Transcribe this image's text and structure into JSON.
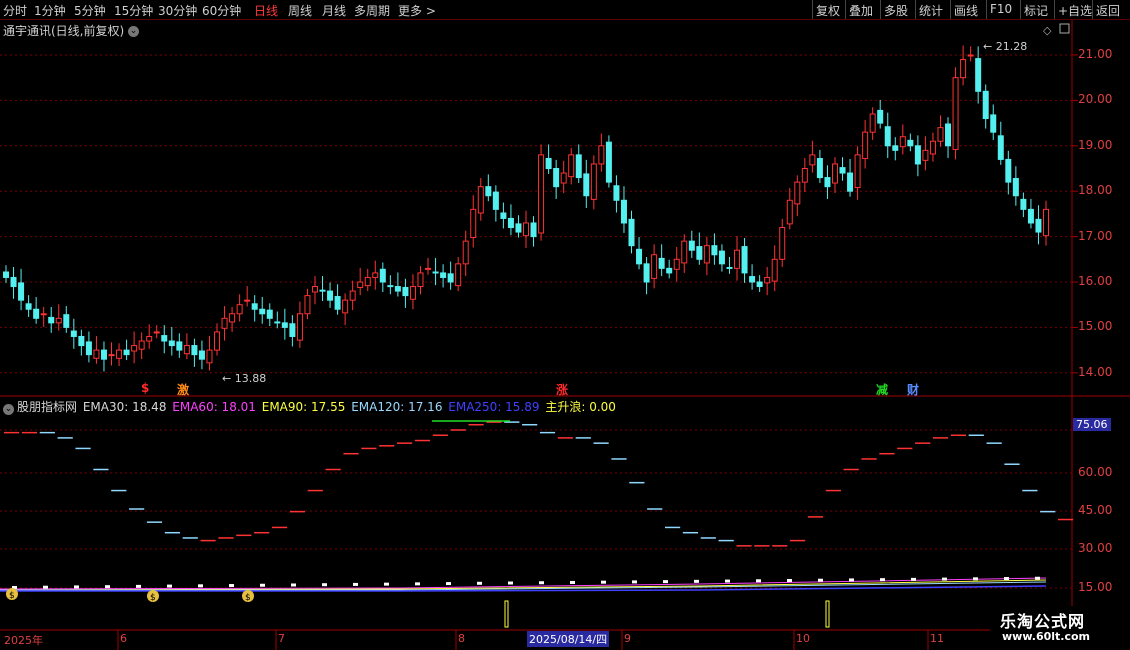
{
  "toolbar": {
    "left": [
      "分时",
      "1分钟",
      "5分钟",
      "15分钟",
      "30分钟",
      "60分钟",
      "日线",
      "周线",
      "月线",
      "多周期",
      "更多 >"
    ],
    "active": "日线",
    "right": [
      "复权",
      "叠加",
      "多股",
      "统计",
      "画线",
      "F10",
      "标记",
      "+自选",
      "返回"
    ]
  },
  "main_title": "通宇通讯(日线,前复权)",
  "price_axis": [
    "21.00",
    "20.00",
    "19.00",
    "18.00",
    "17.00",
    "16.00",
    "15.00",
    "14.00"
  ],
  "high_label": "21.28",
  "low_label": "13.88",
  "markers": [
    {
      "text": "$",
      "color": "#ff2a2a"
    },
    {
      "text": "激",
      "color": "#ff8c1a"
    },
    {
      "text": "涨",
      "color": "#ff2a2a"
    },
    {
      "text": "减",
      "color": "#22dd22"
    },
    {
      "text": "财",
      "color": "#5a8cff"
    }
  ],
  "indicator": {
    "name": "股朋指标网",
    "items": [
      {
        "label": "EMA30: 18.48",
        "color": "#d8d8d8"
      },
      {
        "label": "EMA60: 18.01",
        "color": "#ff40ff"
      },
      {
        "label": "EMA90: 17.55",
        "color": "#ffff40"
      },
      {
        "label": "EMA120: 17.16",
        "color": "#9ad8ff"
      },
      {
        "label": "EMA250: 15.89",
        "color": "#4040ff"
      },
      {
        "label": "主升浪: 0.00",
        "color": "#ffff40"
      }
    ],
    "axis": [
      "75.06",
      "60.00",
      "45.00",
      "30.00",
      "15.00"
    ],
    "current": "75.06"
  },
  "dates": [
    "2025年",
    "6",
    "7",
    "8",
    "9",
    "10",
    "11"
  ],
  "cursor_date": "2025/08/14/四",
  "watermark": {
    "line1": "乐淘公式网",
    "line2": "www.60lt.com"
  },
  "colors": {
    "up": "#ff3333",
    "down": "#54f0f0",
    "grid": "#7a0000"
  }
}
